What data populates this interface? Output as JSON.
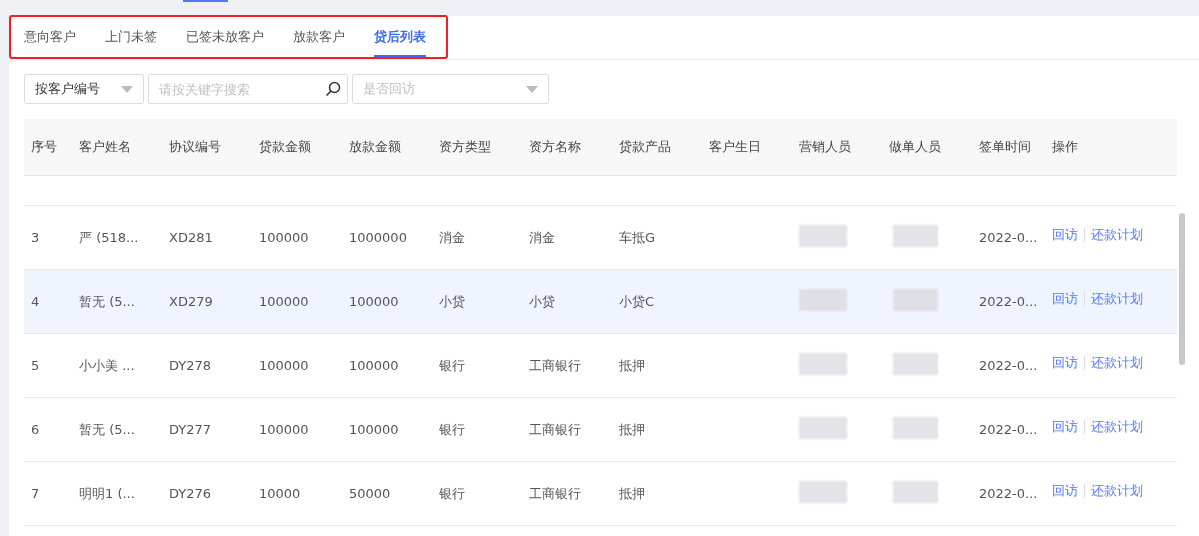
{
  "tabs": [
    {
      "label": "意向客户",
      "selected": false
    },
    {
      "label": "上门未签",
      "selected": false
    },
    {
      "label": "已签未放客户",
      "selected": false
    },
    {
      "label": "放款客户",
      "selected": false
    },
    {
      "label": "贷后列表",
      "selected": true
    }
  ],
  "filters": {
    "search_type": {
      "value": "按客户编号"
    },
    "search": {
      "placeholder": "请按关键字搜索"
    },
    "visit_filter": {
      "placeholder": "是否回访"
    }
  },
  "table": {
    "columns": [
      "序号",
      "客户姓名",
      "协议编号",
      "贷款金额",
      "放款金额",
      "资方类型",
      "资方名称",
      "贷款产品",
      "客户生日",
      "营销人员",
      "做单人员",
      "签单时间",
      "操作"
    ],
    "rows": [
      {
        "no": "3",
        "name": "严 (518...",
        "agreement": "XD281",
        "loan_amount": "100000",
        "disbursed": "1000000",
        "funder_type": "消金",
        "funder_name": "消金",
        "product": "车抵G",
        "marketer_blurred": true,
        "maker_blurred": true,
        "signed": "2022-0...",
        "actions": [
          "回访",
          "还款计划"
        ],
        "selected": false
      },
      {
        "no": "4",
        "name": "暂无 (5...",
        "agreement": "XD279",
        "loan_amount": "100000",
        "disbursed": "100000",
        "funder_type": "小贷",
        "funder_name": "小贷",
        "product": "小贷C",
        "marketer_blurred": true,
        "maker_blurred": true,
        "signed": "2022-0...",
        "actions": [
          "回访",
          "还款计划"
        ],
        "selected": true
      },
      {
        "no": "5",
        "name": "小小美 ...",
        "agreement": "DY278",
        "loan_amount": "100000",
        "disbursed": "100000",
        "funder_type": "银行",
        "funder_name": "工商银行",
        "product": "抵押",
        "marketer_blurred": true,
        "maker_blurred": true,
        "signed": "2022-0...",
        "actions": [
          "回访",
          "还款计划"
        ],
        "selected": false
      },
      {
        "no": "6",
        "name": "暂无 (5...",
        "agreement": "DY277",
        "loan_amount": "100000",
        "disbursed": "100000",
        "funder_type": "银行",
        "funder_name": "工商银行",
        "product": "抵押",
        "marketer_blurred": true,
        "maker_blurred": true,
        "signed": "2022-0...",
        "actions": [
          "回访",
          "还款计划"
        ],
        "selected": false
      },
      {
        "no": "7",
        "name": "明明1 (...",
        "agreement": "DY276",
        "loan_amount": "10000",
        "disbursed": "50000",
        "funder_type": "银行",
        "funder_name": "工商银行",
        "product": "抵押",
        "marketer_blurred": true,
        "maker_blurred": true,
        "signed": "2022-0...",
        "actions": [
          "回访",
          "还款计划"
        ],
        "selected": false
      }
    ]
  }
}
